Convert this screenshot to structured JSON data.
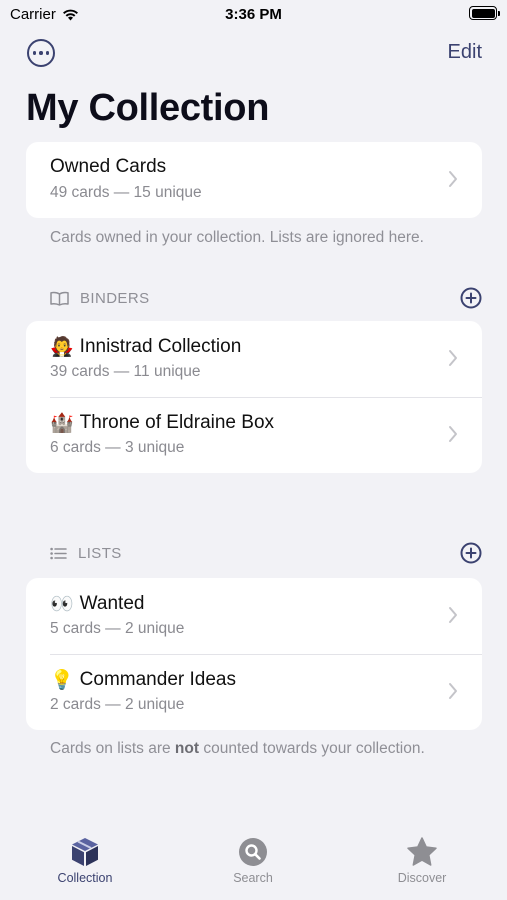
{
  "status_bar": {
    "carrier": "Carrier",
    "time": "3:36 PM"
  },
  "nav": {
    "edit_label": "Edit",
    "title": "My Collection"
  },
  "owned": {
    "title": "Owned Cards",
    "subtitle": "49 cards — 15 unique",
    "footnote": "Cards owned in your collection. Lists are ignored here."
  },
  "binders": {
    "header": "BINDERS",
    "items": [
      {
        "emoji": "🧛",
        "title": "Innistrad Collection",
        "subtitle": "39 cards — 11 unique"
      },
      {
        "emoji": "🏰",
        "title": "Throne of Eldraine Box",
        "subtitle": "6 cards — 3 unique"
      }
    ]
  },
  "lists": {
    "header": "LISTS",
    "items": [
      {
        "emoji": "👀",
        "title": "Wanted",
        "subtitle": "5 cards — 2 unique"
      },
      {
        "emoji": "💡",
        "title": "Commander Ideas",
        "subtitle": "2 cards — 2 unique"
      }
    ],
    "footnote_pre": "Cards on lists are ",
    "footnote_bold": "not",
    "footnote_post": " counted towards your collection."
  },
  "tabs": [
    {
      "label": "Collection",
      "icon": "box-icon",
      "active": true
    },
    {
      "label": "Search",
      "icon": "search-icon",
      "active": false
    },
    {
      "label": "Discover",
      "icon": "star-icon",
      "active": false
    }
  ],
  "colors": {
    "accent": "#3b4270",
    "background": "#f2f2f6",
    "inactive": "#8e8e93"
  }
}
